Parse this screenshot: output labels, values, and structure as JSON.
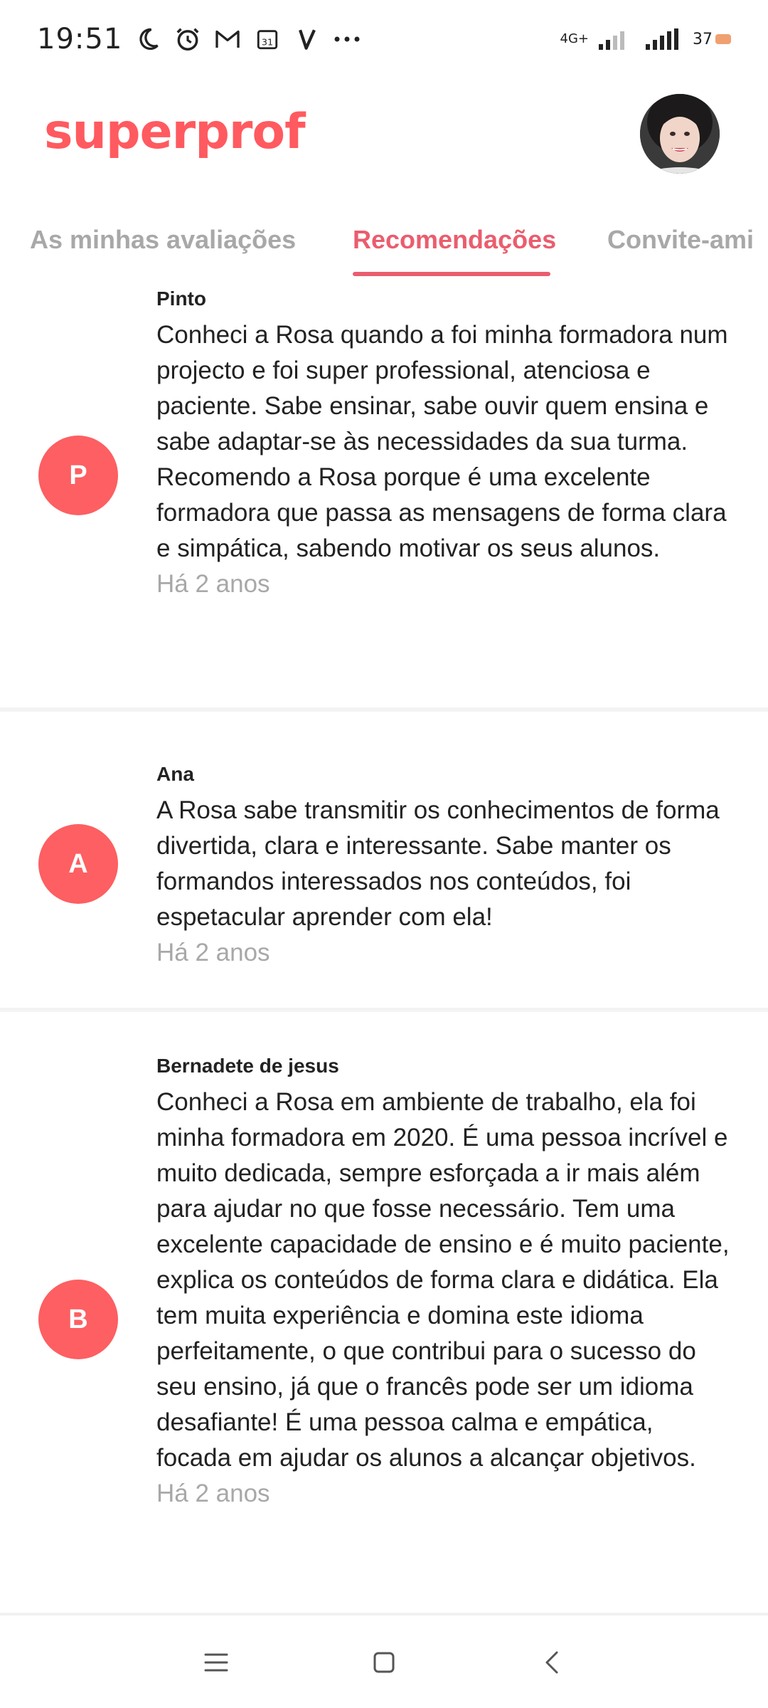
{
  "status_bar": {
    "time": "19:51",
    "icons": [
      "moon-icon",
      "alarm-icon",
      "gmail-icon",
      "calendar-icon",
      "v-app-icon",
      "more-dots-icon"
    ],
    "network_label": "4G+",
    "battery": "37"
  },
  "header": {
    "logo": "superprof"
  },
  "tabs": [
    {
      "label": "As minhas avaliações",
      "active": false
    },
    {
      "label": "Recomendações",
      "active": true
    },
    {
      "label": "Convite-ami",
      "active": false
    }
  ],
  "recommendations": [
    {
      "initial": "P",
      "name": "Pinto",
      "text": "Conheci a Rosa quando a foi minha formadora num projecto e foi super professional, atenciosa e paciente. Sabe ensinar, sabe ouvir quem ensina e sabe adaptar-se às necessidades da sua turma. Recomendo a Rosa porque é uma excelente formadora que passa as mensagens de forma clara e simpática, sabendo motivar os seus alunos.",
      "time": "Há 2 anos"
    },
    {
      "initial": "A",
      "name": "Ana",
      "text": "A Rosa sabe transmitir os conhecimentos de forma divertida, clara e interessante. Sabe manter os formandos interessados nos conteúdos, foi espetacular aprender com ela!",
      "time": "Há 2 anos"
    },
    {
      "initial": "B",
      "name": "Bernadete de jesus",
      "text": "Conheci a Rosa em ambiente de trabalho, ela foi minha formadora em 2020. É uma pessoa incrível e muito dedicada, sempre esforçada a ir mais além para ajudar no que fosse necessário. Tem uma excelente capacidade de ensino e é muito paciente, explica os conteúdos de forma clara e didática. Ela tem muita experiência e domina este idioma perfeitamente, o que contribui para o sucesso do seu ensino, já que o francês pode ser um idioma desafiante! É uma pessoa calma e empática, focada em ajudar os alunos a alcançar objetivos.",
      "time": "Há 2 anos"
    }
  ],
  "colors": {
    "brand": "#ff5a5f",
    "tab_active": "#ea5d6e",
    "avatar_bg": "#fd5f62",
    "muted": "#a8a8a8"
  }
}
